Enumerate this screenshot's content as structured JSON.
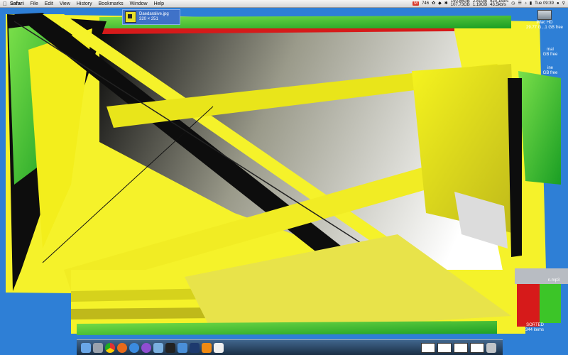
{
  "menubar": {
    "app": "Safari",
    "items": [
      "File",
      "Edit",
      "View",
      "History",
      "Bookmarks",
      "Window",
      "Help"
    ],
    "extras": {
      "mail_count": "746",
      "disk_line1": "190.86GB",
      "disk_line2": "107.73GB",
      "mem_line1": "2.81GB",
      "mem_line2": "1.19GB",
      "net_line1": "520.1kb/s",
      "net_line2": "43.5kb/s",
      "clock": "Tue 09:39"
    }
  },
  "file_chip": {
    "name": "Daedaralive.jpg",
    "size": "320 × 251"
  },
  "desktop_icons": [
    {
      "name": "iMac HD",
      "sub": "29.77 G...1 GB free"
    },
    {
      "name": "mal",
      "sub": "GB free"
    },
    {
      "name": "ine",
      "sub": "GB free"
    },
    {
      "name": "n.mp3",
      "sub": ""
    },
    {
      "name": "SORTED",
      "sub": "344 items"
    }
  ],
  "colors": {
    "desktop": "#2e7fd6",
    "yellow": "#f5f22a",
    "green": "#3cc528",
    "red": "#d61a1a",
    "black": "#0d0d0d"
  },
  "dock_icons": [
    "finder-icon",
    "system-icon",
    "chrome-icon",
    "firefox-icon",
    "safari-icon",
    "itunes-icon",
    "preview-icon",
    "terminal-icon",
    "mail-icon",
    "photoshop-icon",
    "vlc-icon",
    "calendar-icon",
    "window-thumb-1",
    "window-thumb-2",
    "window-thumb-3",
    "window-thumb-4",
    "trash-icon"
  ]
}
